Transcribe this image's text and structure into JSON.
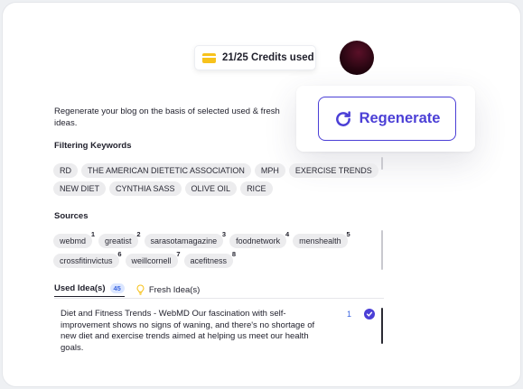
{
  "header": {
    "credits_label": "21/25 Credits used"
  },
  "regenerate": {
    "label": "Regenerate"
  },
  "description": "Regenerate your blog on the basis of selected used & fresh ideas.",
  "filtering_keywords": {
    "title": "Filtering Keywords",
    "items": [
      "RD",
      "THE AMERICAN DIETETIC ASSOCIATION",
      "MPH",
      "EXERCISE TRENDS",
      "NEW DIET",
      "CYNTHIA SASS",
      "OLIVE OIL",
      "RICE"
    ]
  },
  "sources": {
    "title": "Sources",
    "items": [
      {
        "label": "webmd",
        "num": "1"
      },
      {
        "label": "greatist",
        "num": "2"
      },
      {
        "label": "sarasotamagazine",
        "num": "3"
      },
      {
        "label": "foodnetwork",
        "num": "4"
      },
      {
        "label": "menshealth",
        "num": "5"
      },
      {
        "label": "crossfitinvictus",
        "num": "6"
      },
      {
        "label": "weillcornell",
        "num": "7"
      },
      {
        "label": "acefitness",
        "num": "8"
      }
    ]
  },
  "tabs": {
    "used_label": "Used Idea(s)",
    "used_count": "45",
    "fresh_label": "Fresh Idea(s)"
  },
  "idea": {
    "text": "Diet and Fitness Trends - WebMD Our fascination with self-improvement shows no signs of waning, and there's no shortage of new diet and exercise trends aimed at helping us meet our health goals.",
    "num": "1"
  },
  "colors": {
    "accent": "#4b3fd6",
    "credit_icon": "#f7c21c",
    "chip_bg": "#ececee",
    "count_badge": "#dbe6ff"
  }
}
